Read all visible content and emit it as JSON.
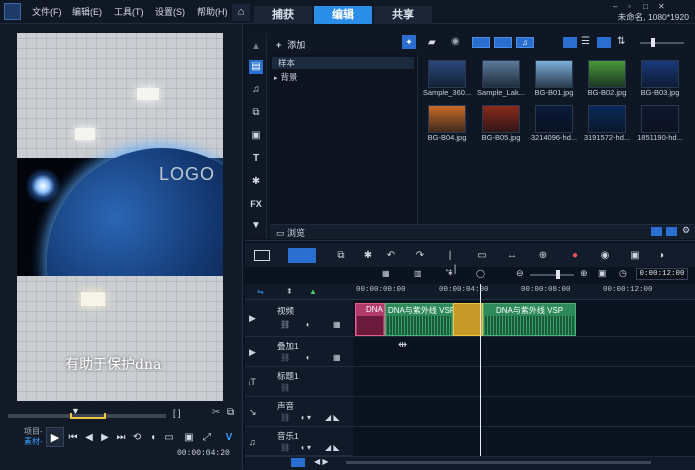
{
  "menubar": {
    "items": [
      "文件(F)",
      "编辑(E)",
      "工具(T)",
      "设置(S)",
      "帮助(H)"
    ],
    "tabs": [
      "捕获",
      "编辑",
      "共享"
    ],
    "active_tab": "编辑",
    "project_info": "未命名, 1080*1920",
    "home_icon": "home-icon"
  },
  "preview": {
    "logo_text": "LOGO",
    "caption": "有助于保护dna",
    "mode_project": "项目-",
    "mode_clip": "素材-",
    "timecode": "00:00:04:20"
  },
  "library": {
    "add_label": "添加",
    "folders": [
      "样本",
      "背景"
    ],
    "selected_folder": "样本",
    "browse_label": "浏览",
    "thumbnails": [
      {
        "label": "Sample_360...",
        "color": "#2a4a7a"
      },
      {
        "label": "Sample_Lak...",
        "color": "#5a7a9a"
      },
      {
        "label": "BG-B01.jpg",
        "color": "#7ab0d8"
      },
      {
        "label": "BG-B02.jpg",
        "color": "#4a9a3a"
      },
      {
        "label": "BG-B03.jpg",
        "color": "#1a3a7a"
      },
      {
        "label": "BG-B04.jpg",
        "color": "#c86a2a"
      },
      {
        "label": "BG-B05.jpg",
        "color": "#8a2a1a"
      },
      {
        "label": "3214096-hd...",
        "color": "#0a1a3a"
      },
      {
        "label": "3191572-hd...",
        "color": "#0a2a5a"
      },
      {
        "label": "1851190-hd...",
        "color": "#101830"
      }
    ]
  },
  "timeline": {
    "timecode": "0:00:12:00",
    "ruler": [
      "00:00:00:00",
      "00:00:04:00",
      "00:00:08:00",
      "00:00:12:00"
    ],
    "tracks": [
      {
        "name": "视频",
        "icon": "video-track-icon"
      },
      {
        "name": "叠加1",
        "icon": "overlay-track-icon"
      },
      {
        "name": "标题1",
        "icon": "title-track-icon"
      },
      {
        "name": "声音",
        "icon": "voice-track-icon"
      },
      {
        "name": "音乐1",
        "icon": "music-track-icon"
      }
    ],
    "clips": [
      {
        "label": "DNA",
        "color": "#c23a6a"
      },
      {
        "label": "DNA与紫外线 VSP",
        "color": "#2e8a5a"
      },
      {
        "label": "DNA与紫外线 VSP",
        "color": "#2e8a5a"
      }
    ]
  },
  "colors": {
    "accent": "#2a8ee8",
    "trim": "#f0c340"
  }
}
